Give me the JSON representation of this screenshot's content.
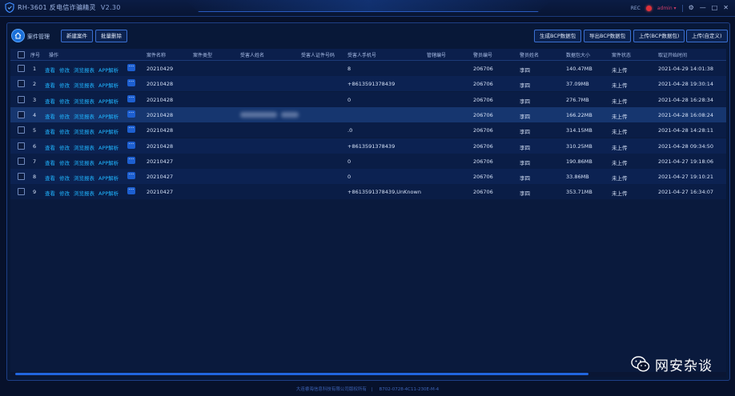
{
  "app": {
    "title": "RH-3601 反电信诈骗精灵",
    "version": "V2.30",
    "rec_label": "REC",
    "user": "admin ▾"
  },
  "window_controls": {
    "settings": "⚙",
    "minimize": "—",
    "maximize": "□",
    "close": "✕"
  },
  "toolbar": {
    "section_label": "案件管理",
    "new_case": "新建案件",
    "batch_delete": "批量删除",
    "gen_bcp": "生成BCP数据包",
    "export_bcp": "导出BCP数据包",
    "upload_bcp": "上传(BCP数据包)",
    "upload_custom": "上传(自定义)"
  },
  "table": {
    "headers": [
      "序号",
      "操作",
      "案件名称",
      "案件类型",
      "受害人姓名",
      "受害人证件号码",
      "受害人手机号",
      "管辖编号",
      "警员编号",
      "警员姓名",
      "数据包大小",
      "案件状态",
      "取证开始时间"
    ],
    "actions": [
      "查看",
      "修改",
      "浏览报表",
      "APP解析"
    ],
    "more": "···",
    "rows": [
      {
        "no": "1",
        "name": "20210429",
        "phone": "8",
        "officer_no": "206706",
        "officer": "李四",
        "size": "140.47MB",
        "status": "未上传",
        "time": "2021-04-29 14:01:38"
      },
      {
        "no": "2",
        "name": "20210428",
        "phone": "+8613591378439",
        "officer_no": "206706",
        "officer": "李四",
        "size": "37.09MB",
        "status": "未上传",
        "time": "2021-04-28 19:30:14"
      },
      {
        "no": "3",
        "name": "20210428",
        "phone": "0",
        "officer_no": "206706",
        "officer": "李四",
        "size": "276.7MB",
        "status": "未上传",
        "time": "2021-04-28 16:28:34"
      },
      {
        "no": "4",
        "name": "20210428",
        "phone": "",
        "officer_no": "206706",
        "officer": "李四",
        "size": "166.22MB",
        "status": "未上传",
        "time": "2021-04-28 16:08:24"
      },
      {
        "no": "5",
        "name": "20210428",
        "phone": ".0",
        "officer_no": "206706",
        "officer": "李四",
        "size": "314.15MB",
        "status": "未上传",
        "time": "2021-04-28 14:28:11"
      },
      {
        "no": "6",
        "name": "20210428",
        "phone": "+8613591378439",
        "officer_no": "206706",
        "officer": "李四",
        "size": "310.25MB",
        "status": "未上传",
        "time": "2021-04-28 09:34:50"
      },
      {
        "no": "7",
        "name": "20210427",
        "phone": "0",
        "officer_no": "206706",
        "officer": "李四",
        "size": "190.86MB",
        "status": "未上传",
        "time": "2021-04-27 19:18:06"
      },
      {
        "no": "8",
        "name": "20210427",
        "phone": "0",
        "officer_no": "206706",
        "officer": "李四",
        "size": "33.86MB",
        "status": "未上传",
        "time": "2021-04-27 19:10:21"
      },
      {
        "no": "9",
        "name": "20210427",
        "phone": "+8613591378439,UnKnown",
        "officer_no": "206706",
        "officer": "李四",
        "size": "353.71MB",
        "status": "未上传",
        "time": "2021-04-27 16:34:07"
      }
    ]
  },
  "footer": {
    "company": "大连睿海信息科技有限公司版权所有",
    "code": "B702-0728-4C11-230E-M-4"
  },
  "watermark": {
    "text": "网安杂谈"
  },
  "colors": {
    "background": "#07112b",
    "accent": "#1fb4ff",
    "button_border": "#3a6fd2",
    "selected_row": "#16366f"
  }
}
